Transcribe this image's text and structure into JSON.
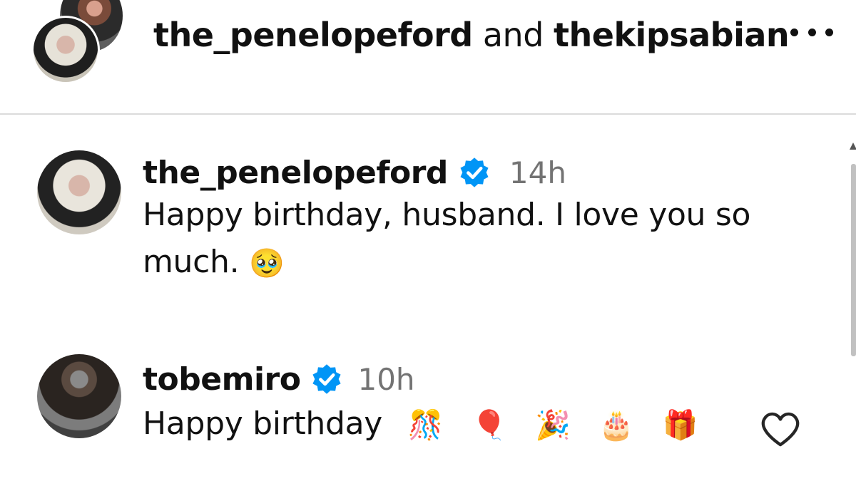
{
  "header": {
    "user_a": "the_penelopeford",
    "joiner": "and",
    "user_b": "thekipsabian"
  },
  "comments": [
    {
      "username": "the_penelopeford",
      "time": "14h",
      "text_line1": "Happy birthday, husband. I love you so",
      "text_line2": "much.",
      "emoji": "🥹"
    },
    {
      "username": "tobemiro",
      "time": "10h",
      "text": "Happy birthday",
      "emojis": [
        "🎊",
        "🎈",
        "🎉",
        "🎂",
        "🎁"
      ]
    }
  ],
  "colors": {
    "verified": "#0095f6",
    "time": "#737373",
    "divider": "#dbdbdb"
  }
}
